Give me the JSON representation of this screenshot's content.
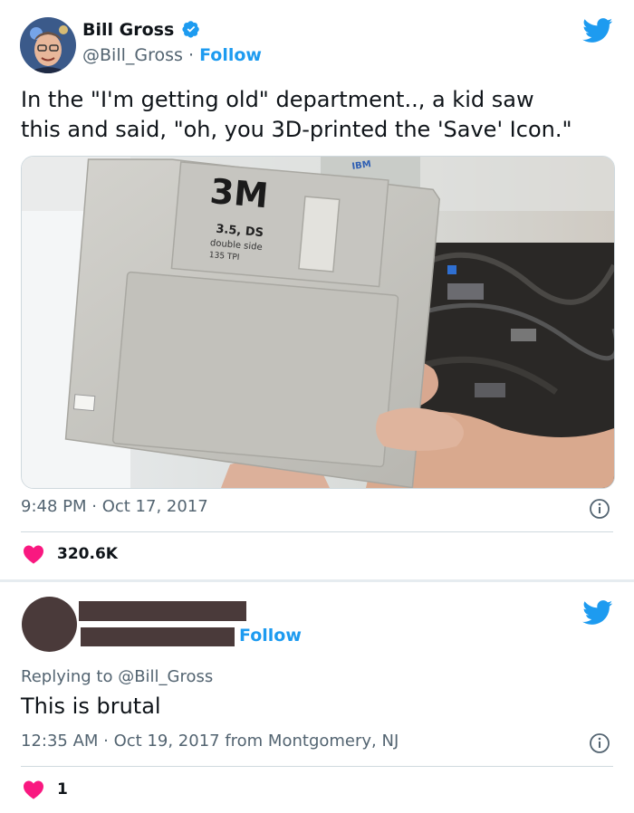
{
  "tweet": {
    "author_name": "Bill Gross",
    "author_handle": "@Bill_Gross",
    "separator": "·",
    "follow_label": "Follow",
    "verified": true,
    "text_line1": "In the \"I'm getting old\" department.., a kid saw",
    "text_line2": "this and said, \"oh, you 3D-printed the 'Save' Icon.\"",
    "photo": {
      "brand": "3M",
      "line1": "3.5, DS",
      "line2": "double side",
      "line3": "135 TPI",
      "corner_logo": "IBM"
    },
    "timestamp": "9:48 PM · Oct 17, 2017",
    "likes": "320.6K"
  },
  "reply": {
    "follow_label": "Follow",
    "replying_to": "Replying to @Bill_Gross",
    "text": "This is brutal",
    "timestamp": "12:35 AM · Oct 19, 2017 from Montgomery, NJ",
    "likes": "1"
  },
  "colors": {
    "brand_blue": "#1d9bf0",
    "like_pink": "#f91880",
    "muted": "#536471",
    "redaction": "#4a3a3a"
  },
  "icons": [
    "twitter-bird-icon",
    "verified-badge-icon",
    "heart-icon",
    "info-icon"
  ]
}
